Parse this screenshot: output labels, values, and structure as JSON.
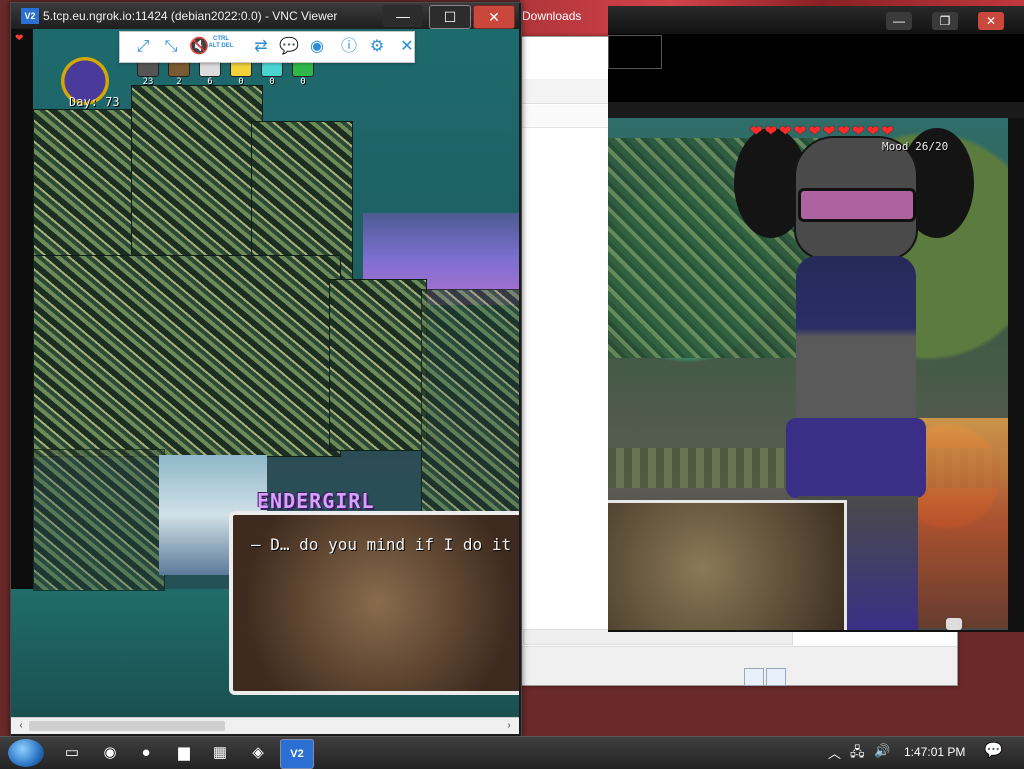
{
  "desktop": {
    "downloads_label": "Downloads"
  },
  "vnc": {
    "logo": "V2",
    "title": "5.tcp.eu.ngrok.io:11424 (debian2022:0.0) - VNC Viewer",
    "controls": {
      "minimize": "—",
      "maximize": "☐",
      "close": "✕"
    },
    "toolbar": [
      {
        "name": "full-screen-icon",
        "glyph": "⤢"
      },
      {
        "name": "scale-icon",
        "glyph": "⤡"
      },
      {
        "name": "mute-audio-icon",
        "glyph": "🔇"
      },
      {
        "name": "ctrl-alt-del-button",
        "glyph": "CTRL ALT DEL"
      },
      {
        "name": "transfer-files-icon",
        "glyph": "⇄"
      },
      {
        "name": "chat-icon",
        "glyph": "💬"
      },
      {
        "name": "record-icon",
        "glyph": "◉"
      },
      {
        "name": "info-icon",
        "glyph": "ⓘ"
      },
      {
        "name": "settings-gear-icon",
        "glyph": "⚙"
      },
      {
        "name": "close-toolbar-icon",
        "glyph": "✕"
      }
    ]
  },
  "game": {
    "day_label": "Day: 73",
    "inventory": [
      {
        "name": "coal",
        "count": "23",
        "color": "#555555"
      },
      {
        "name": "wood",
        "count": "2",
        "color": "#7a5a32"
      },
      {
        "name": "iron",
        "count": "6",
        "color": "#dcdcdc"
      },
      {
        "name": "gold",
        "count": "0",
        "color": "#f2d23a"
      },
      {
        "name": "diamond",
        "count": "0",
        "color": "#4ad4d0"
      },
      {
        "name": "emerald",
        "count": "0",
        "color": "#2fb84a"
      }
    ],
    "speaker": "ENDERGIRL",
    "dialog": "– D… do you mind if I do it a"
  },
  "right_game": {
    "hearts": [
      "❤",
      "❤",
      "❤",
      "❤",
      "❤",
      "❤",
      "❤",
      "❤",
      "❤",
      "❤"
    ],
    "mood": "Mood 26/20",
    "controls": {
      "minimize": "—",
      "maximize": "❐",
      "close": "✕"
    }
  },
  "taskbar": {
    "items": [
      {
        "name": "task-view-icon",
        "glyph": "▭"
      },
      {
        "name": "chrome-icon",
        "glyph": "◉"
      },
      {
        "name": "firefox-icon",
        "glyph": "●"
      },
      {
        "name": "file-explorer-icon",
        "glyph": "▆"
      },
      {
        "name": "remote-desktop-icon",
        "glyph": "▦"
      },
      {
        "name": "game-app-icon",
        "glyph": "◈"
      },
      {
        "name": "vnc-viewer-icon",
        "glyph": "V2"
      }
    ],
    "clock": "1:47:01 PM"
  },
  "colors": {
    "vnc_toolbar_accent": "#2a8ed6",
    "close_red": "#c9483b",
    "heart_red": "#ff2a2a",
    "speaker_purple": "#d8a0ff"
  }
}
